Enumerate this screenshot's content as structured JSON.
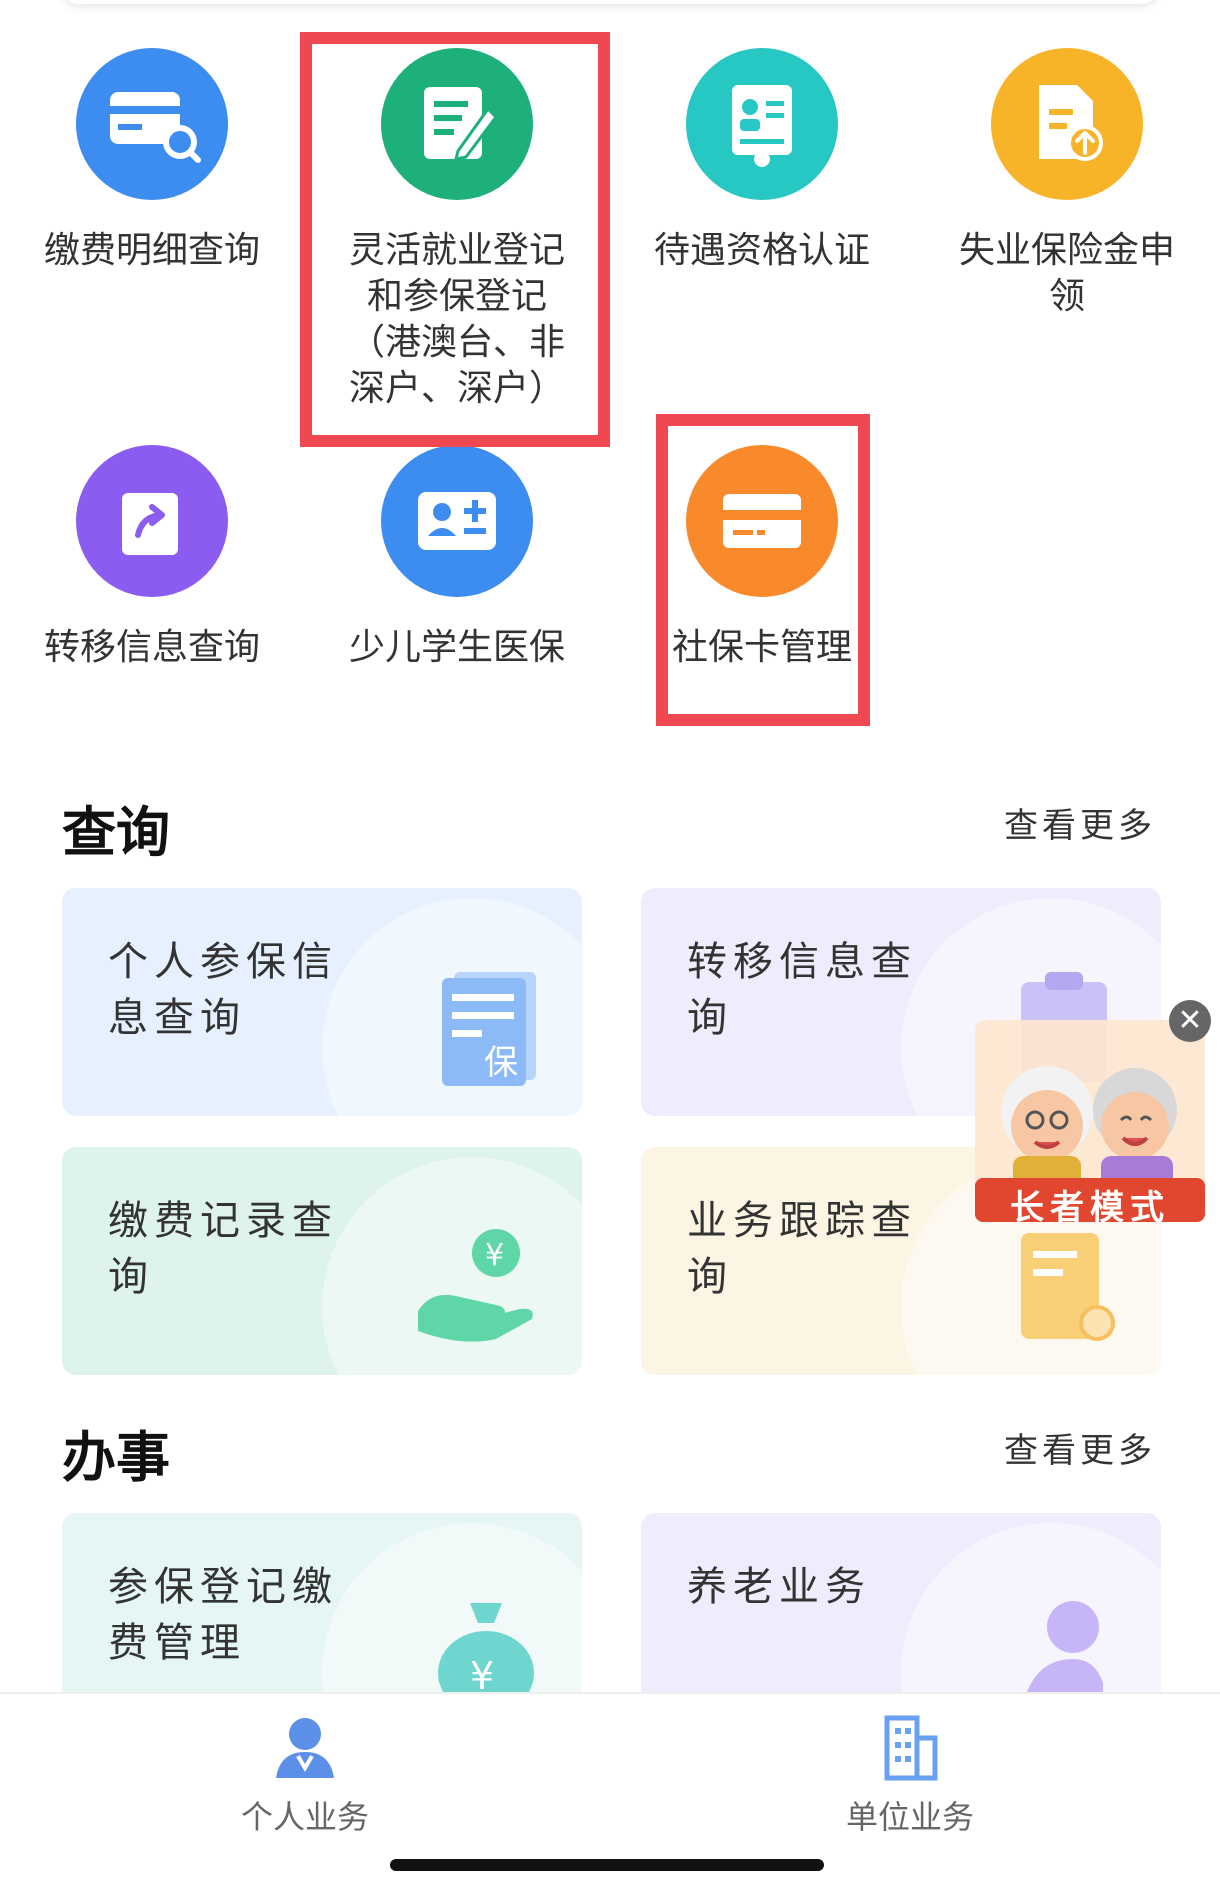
{
  "services": [
    {
      "label": "缴费明细查询",
      "icon": "search-card-icon",
      "color": "#3d8cf0"
    },
    {
      "label": "灵活就业登记和参保登记（港澳台、非深户、深户）",
      "icon": "edit-document-icon",
      "color": "#1db07b"
    },
    {
      "label": "待遇资格认证",
      "icon": "id-certificate-icon",
      "color": "#27c7c4"
    },
    {
      "label": "失业保险金申领",
      "icon": "document-upload-icon",
      "color": "#f8b428"
    },
    {
      "label": "转移信息查询",
      "icon": "share-arrow-icon",
      "color": "#8b5cf0"
    },
    {
      "label": "少儿学生医保",
      "icon": "user-add-card-icon",
      "color": "#3d8cf0"
    },
    {
      "label": "社保卡管理",
      "icon": "card-icon",
      "color": "#f98a2c"
    }
  ],
  "query_section": {
    "title": "查询",
    "more": "查看更多",
    "cards": [
      {
        "label": "个人参保信息查询",
        "icon": "insurance-document-icon"
      },
      {
        "label": "转移信息查询",
        "icon": "clipboard-icon"
      },
      {
        "label": "缴费记录查询",
        "icon": "hand-coin-icon"
      },
      {
        "label": "业务跟踪查询",
        "icon": "tracking-document-icon"
      }
    ]
  },
  "work_section": {
    "title": "办事",
    "more": "查看更多",
    "cards": [
      {
        "label": "参保登记缴费管理",
        "icon": "money-bag-icon"
      },
      {
        "label": "养老业务",
        "icon": "elderly-person-icon"
      }
    ]
  },
  "elder_mode": {
    "label": "长者模式"
  },
  "bottom_nav": [
    {
      "label": "个人业务",
      "icon": "person-icon"
    },
    {
      "label": "单位业务",
      "icon": "building-icon"
    }
  ]
}
